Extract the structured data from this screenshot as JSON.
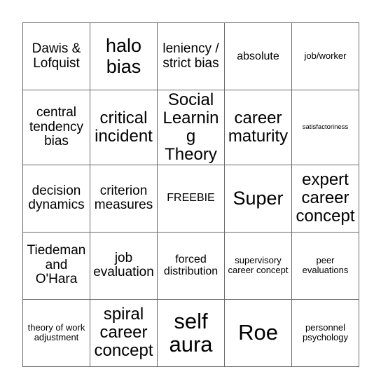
{
  "card": {
    "type": "bingo-card",
    "columns": 5,
    "rows": 5,
    "free_space_label": "FREEBIE",
    "border_color": "#6b6b6b",
    "background_color": "#ffffff",
    "text_color": "#000000",
    "cells": [
      [
        {
          "text": "Dawis & Lofquist",
          "size": "fs-m"
        },
        {
          "text": "halo bias",
          "size": "fs-xl"
        },
        {
          "text": "leniency / strict bias",
          "size": "fs-m"
        },
        {
          "text": "absolute",
          "size": "fs-s"
        },
        {
          "text": "job/worker",
          "size": "fs-xs"
        }
      ],
      [
        {
          "text": "central tendency bias",
          "size": "fs-m"
        },
        {
          "text": "critical incident",
          "size": "fs-l"
        },
        {
          "text": "Social Learning Theory",
          "size": "fs-l"
        },
        {
          "text": "career maturity",
          "size": "fs-l"
        },
        {
          "text": "satisfactoriness",
          "size": "fs-tiny"
        }
      ],
      [
        {
          "text": "decision dynamics",
          "size": "fs-m"
        },
        {
          "text": "criterion measures",
          "size": "fs-m"
        },
        {
          "text": "FREEBIE",
          "size": "fs-s"
        },
        {
          "text": "Super",
          "size": "fs-xl"
        },
        {
          "text": "expert career concept",
          "size": "fs-l"
        }
      ],
      [
        {
          "text": "Tiedeman and O'Hara",
          "size": "fs-m"
        },
        {
          "text": "job evaluation",
          "size": "fs-m"
        },
        {
          "text": "forced distribution",
          "size": "fs-s"
        },
        {
          "text": "supervisory career concept",
          "size": "fs-xs"
        },
        {
          "text": "peer evaluations",
          "size": "fs-xs"
        }
      ],
      [
        {
          "text": "theory of work adjustment",
          "size": "fs-xs"
        },
        {
          "text": "spiral career concept",
          "size": "fs-l"
        },
        {
          "text": "self aura",
          "size": "fs-xxl"
        },
        {
          "text": "Roe",
          "size": "fs-xxl"
        },
        {
          "text": "personnel psychology",
          "size": "fs-xs"
        }
      ]
    ]
  }
}
